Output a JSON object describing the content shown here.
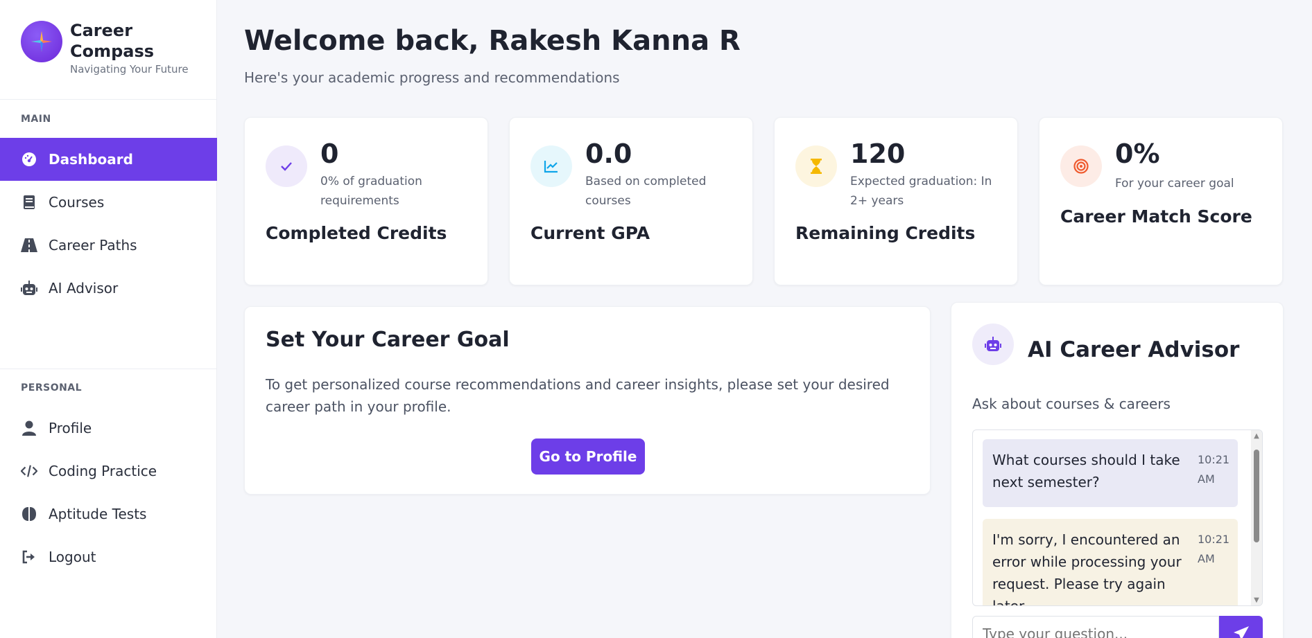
{
  "brand": {
    "title": "Career Compass",
    "subtitle": "Navigating Your Future"
  },
  "sidebar": {
    "main_label": "MAIN",
    "main_items": [
      {
        "label": "Dashboard",
        "icon": "gauge-icon",
        "active": true
      },
      {
        "label": "Courses",
        "icon": "book-icon"
      },
      {
        "label": "Career Paths",
        "icon": "road-icon"
      },
      {
        "label": "AI Advisor",
        "icon": "robot-icon"
      }
    ],
    "personal_label": "PERSONAL",
    "personal_items": [
      {
        "label": "Profile",
        "icon": "user-icon"
      },
      {
        "label": "Coding Practice",
        "icon": "code-icon"
      },
      {
        "label": "Aptitude Tests",
        "icon": "brain-icon"
      },
      {
        "label": "Logout",
        "icon": "logout-icon"
      }
    ]
  },
  "header": {
    "title": "Welcome back, Rakesh Kanna R",
    "subtitle": "Here's your academic progress and recommendations"
  },
  "stats": [
    {
      "value": "0",
      "desc": "0% of graduation requirements",
      "title": "Completed Credits",
      "icon": "check-icon",
      "color": "#6d3ee8",
      "bg": "#efeafb"
    },
    {
      "value": "0.0",
      "desc": "Based on completed courses",
      "title": "Current GPA",
      "icon": "chart-line-icon",
      "color": "#0ea5e9",
      "bg": "#e6f7fc"
    },
    {
      "value": "120",
      "desc": "Expected graduation: In 2+ years",
      "title": "Remaining Credits",
      "icon": "hourglass-icon",
      "color": "#f5b800",
      "bg": "#fdf5df"
    },
    {
      "value": "0%",
      "desc": "For your career goal",
      "title": "Career Match Score",
      "icon": "target-icon",
      "color": "#ef5a2e",
      "bg": "#fdece6"
    }
  ],
  "goal": {
    "title": "Set Your Career Goal",
    "text": "To get personalized course recommendations and career insights, please set your desired career path in your profile.",
    "button": "Go to Profile"
  },
  "advisor": {
    "title": "AI Career Advisor",
    "subtitle": "Ask about courses & careers",
    "messages": [
      {
        "role": "user",
        "text": "What courses should I take next semester?",
        "time": "10:21 AM"
      },
      {
        "role": "bot",
        "text": "I'm sorry, I encountered an error while processing your request. Please try again later.",
        "time": "10:21 AM"
      }
    ],
    "input_placeholder": "Type your question..."
  }
}
